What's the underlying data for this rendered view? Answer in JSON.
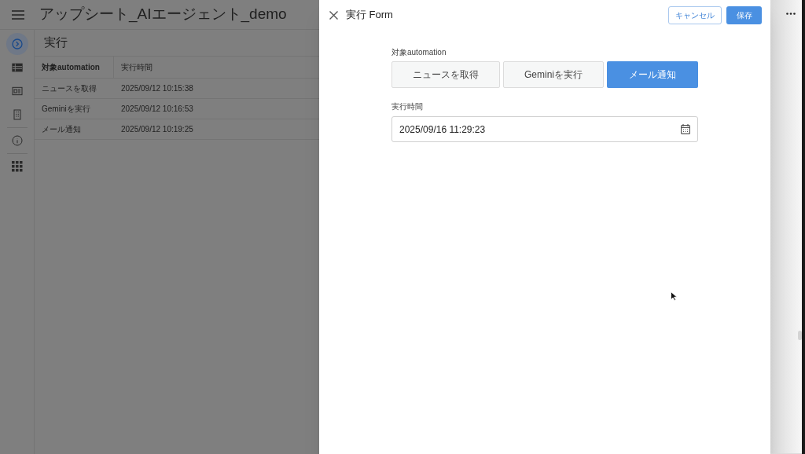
{
  "app": {
    "title": "アップシート_AIエージェント_demo",
    "view_title": "実行"
  },
  "sidebar": {
    "items": [
      {
        "kind": "automation",
        "selected": true
      },
      {
        "kind": "table",
        "selected": false
      },
      {
        "kind": "card",
        "selected": false
      },
      {
        "kind": "building",
        "selected": false
      },
      {
        "kind": "info",
        "selected": false
      },
      {
        "kind": "apps",
        "selected": false
      }
    ]
  },
  "table": {
    "columns": [
      "対象automation",
      "実行時間"
    ],
    "rows": [
      [
        "ニュースを取得",
        "2025/09/12 10:15:38"
      ],
      [
        "Geminiを実行",
        "2025/09/12 10:16:53"
      ],
      [
        "メール通知",
        "2025/09/12 10:19:25"
      ]
    ]
  },
  "form": {
    "title": "実行 Form",
    "cancel": "キャンセル",
    "save": "保存",
    "choice": {
      "label": "対象automation",
      "options": [
        {
          "label": "ニュースを取得",
          "selected": false
        },
        {
          "label": "Geminiを実行",
          "selected": false
        },
        {
          "label": "メール通知",
          "selected": true
        }
      ]
    },
    "datetime": {
      "label": "実行時間",
      "value": "2025/09/16 11:29:23"
    }
  }
}
